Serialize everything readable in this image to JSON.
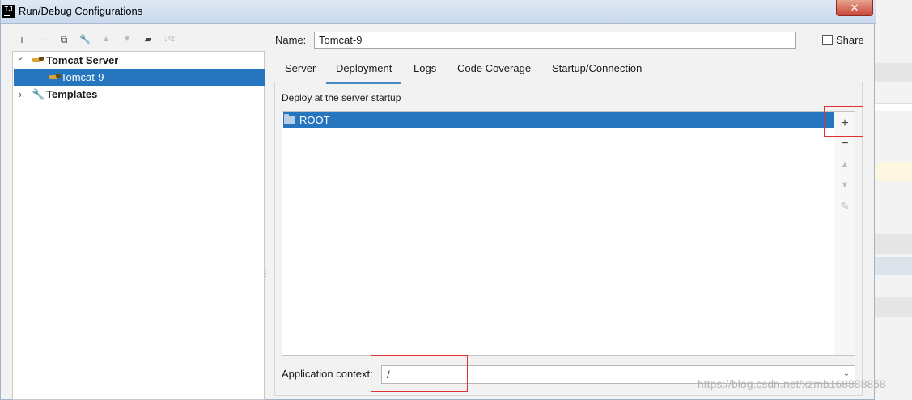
{
  "window": {
    "title": "Run/Debug Configurations",
    "close_glyph": "✕",
    "app_icon_text": "IJ"
  },
  "toolbar": {
    "add_glyph": "+",
    "remove_glyph": "−",
    "copy_glyph": "⧉",
    "edit_glyph": "🔧",
    "move_up_glyph": "▲",
    "move_down_glyph": "▼",
    "folder_glyph": "▰",
    "sort_glyph": "↓ᵃz"
  },
  "tree": {
    "items": [
      {
        "label": "Tomcat Server",
        "expander": "⌄",
        "icon": "tomcat-icon"
      },
      {
        "label": "Tomcat-9",
        "icon": "tomcat-icon"
      },
      {
        "label": "Templates",
        "expander": "›",
        "icon": "wrench-icon"
      }
    ]
  },
  "name_field": {
    "label": "Name:",
    "value": "Tomcat-9"
  },
  "share": {
    "label": "Share",
    "checked": false
  },
  "tabs": [
    {
      "label": "Server"
    },
    {
      "label": "Deployment",
      "active": true
    },
    {
      "label": "Logs"
    },
    {
      "label": "Code Coverage"
    },
    {
      "label": "Startup/Connection"
    }
  ],
  "deployment": {
    "heading": "Deploy at the server startup",
    "artifacts": [
      {
        "label": "ROOT",
        "icon": "folder-icon"
      }
    ],
    "side_buttons": {
      "add": "+",
      "remove": "−",
      "up": "▲",
      "down": "▼",
      "edit": "✎"
    },
    "app_context": {
      "label": "Application context:",
      "value": "/"
    }
  },
  "watermark": "https://blog.csdn.net/xzmb168888858",
  "colors": {
    "selection": "#2675bf",
    "highlight_box": "#e03030",
    "tab_underline": "#4a88c7"
  }
}
